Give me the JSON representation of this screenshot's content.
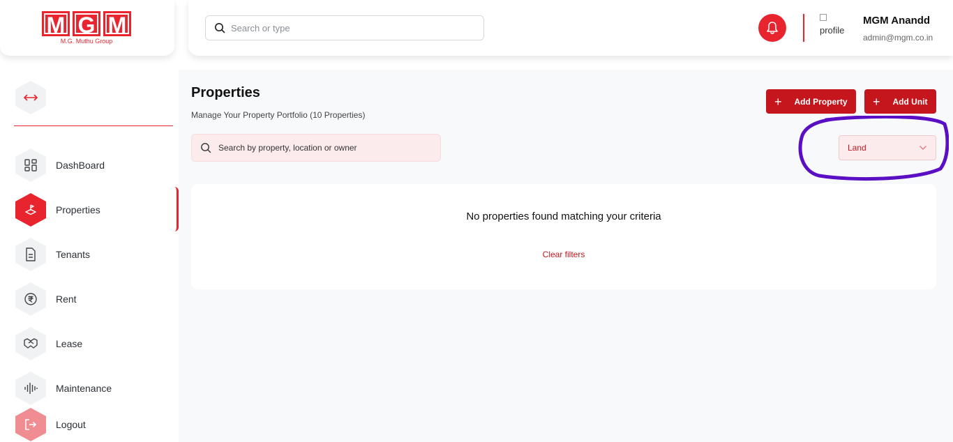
{
  "brand": {
    "letters": [
      "M",
      "G",
      "M"
    ],
    "subtitle": "M.G. Muthu Group"
  },
  "header": {
    "search_placeholder": "Search or type",
    "avatar_alt": "profile",
    "user_name": "MGM Anandd",
    "user_email": "admin@mgm.co.in"
  },
  "sidebar": {
    "items": [
      {
        "label": "DashBoard",
        "icon": "dashboard-grid-icon"
      },
      {
        "label": "Properties",
        "icon": "properties-icon",
        "active": true
      },
      {
        "label": "Tenants",
        "icon": "document-icon"
      },
      {
        "label": "Rent",
        "icon": "rupee-coin-icon"
      },
      {
        "label": "Lease",
        "icon": "handshake-icon"
      },
      {
        "label": "Maintenance",
        "icon": "waveform-icon"
      }
    ],
    "logout_label": "Logout"
  },
  "main": {
    "title": "Properties",
    "subtitle": "Manage Your Property Portfolio (10 Properties)",
    "add_property_label": "Add Property",
    "add_unit_label": "Add Unit",
    "search_placeholder": "Search by property, location or owner",
    "filter_value": "Land",
    "empty_message": "No properties found matching your criteria",
    "clear_filters_label": "Clear filters"
  },
  "colors": {
    "brand_red": "#e8252f",
    "button_red": "#c4161c",
    "annotation_purple": "#5b0fc4"
  }
}
